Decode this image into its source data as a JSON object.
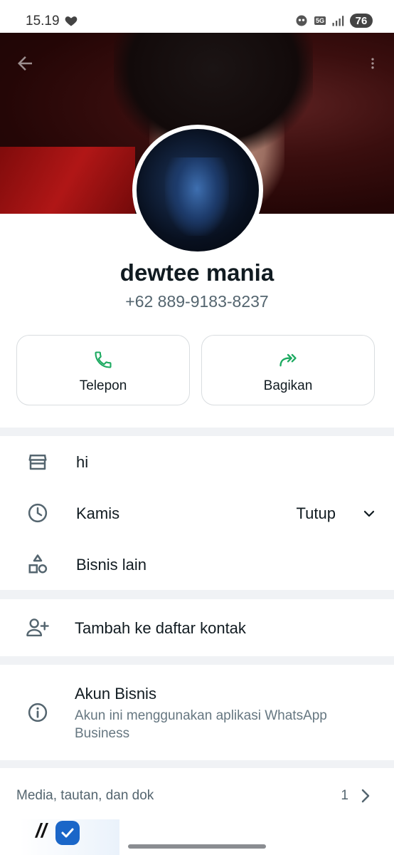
{
  "status_bar": {
    "time": "15.19",
    "network": "5G",
    "battery": "76"
  },
  "header": {
    "back_icon": "arrow-left-icon",
    "menu_icon": "more-vert-icon"
  },
  "profile": {
    "name": "dewtee mania",
    "phone": "+62 889-9183-8237"
  },
  "actions": [
    {
      "label": "Telepon",
      "icon": "phone-icon"
    },
    {
      "label": "Bagikan",
      "icon": "share-forward-icon"
    }
  ],
  "business_info": {
    "description": "hi",
    "hours_day": "Kamis",
    "hours_status": "Tutup",
    "other_business": "Bisnis lain"
  },
  "add_contact": {
    "label": "Tambah ke daftar kontak"
  },
  "business_account": {
    "title": "Akun Bisnis",
    "subtitle": "Akun ini menggunakan aplikasi WhatsApp Business"
  },
  "media": {
    "title": "Media, tautan, dan dok",
    "count": "1"
  },
  "colors": {
    "accent_green": "#1daa61",
    "text_primary": "#111b21",
    "text_secondary": "#667781"
  }
}
